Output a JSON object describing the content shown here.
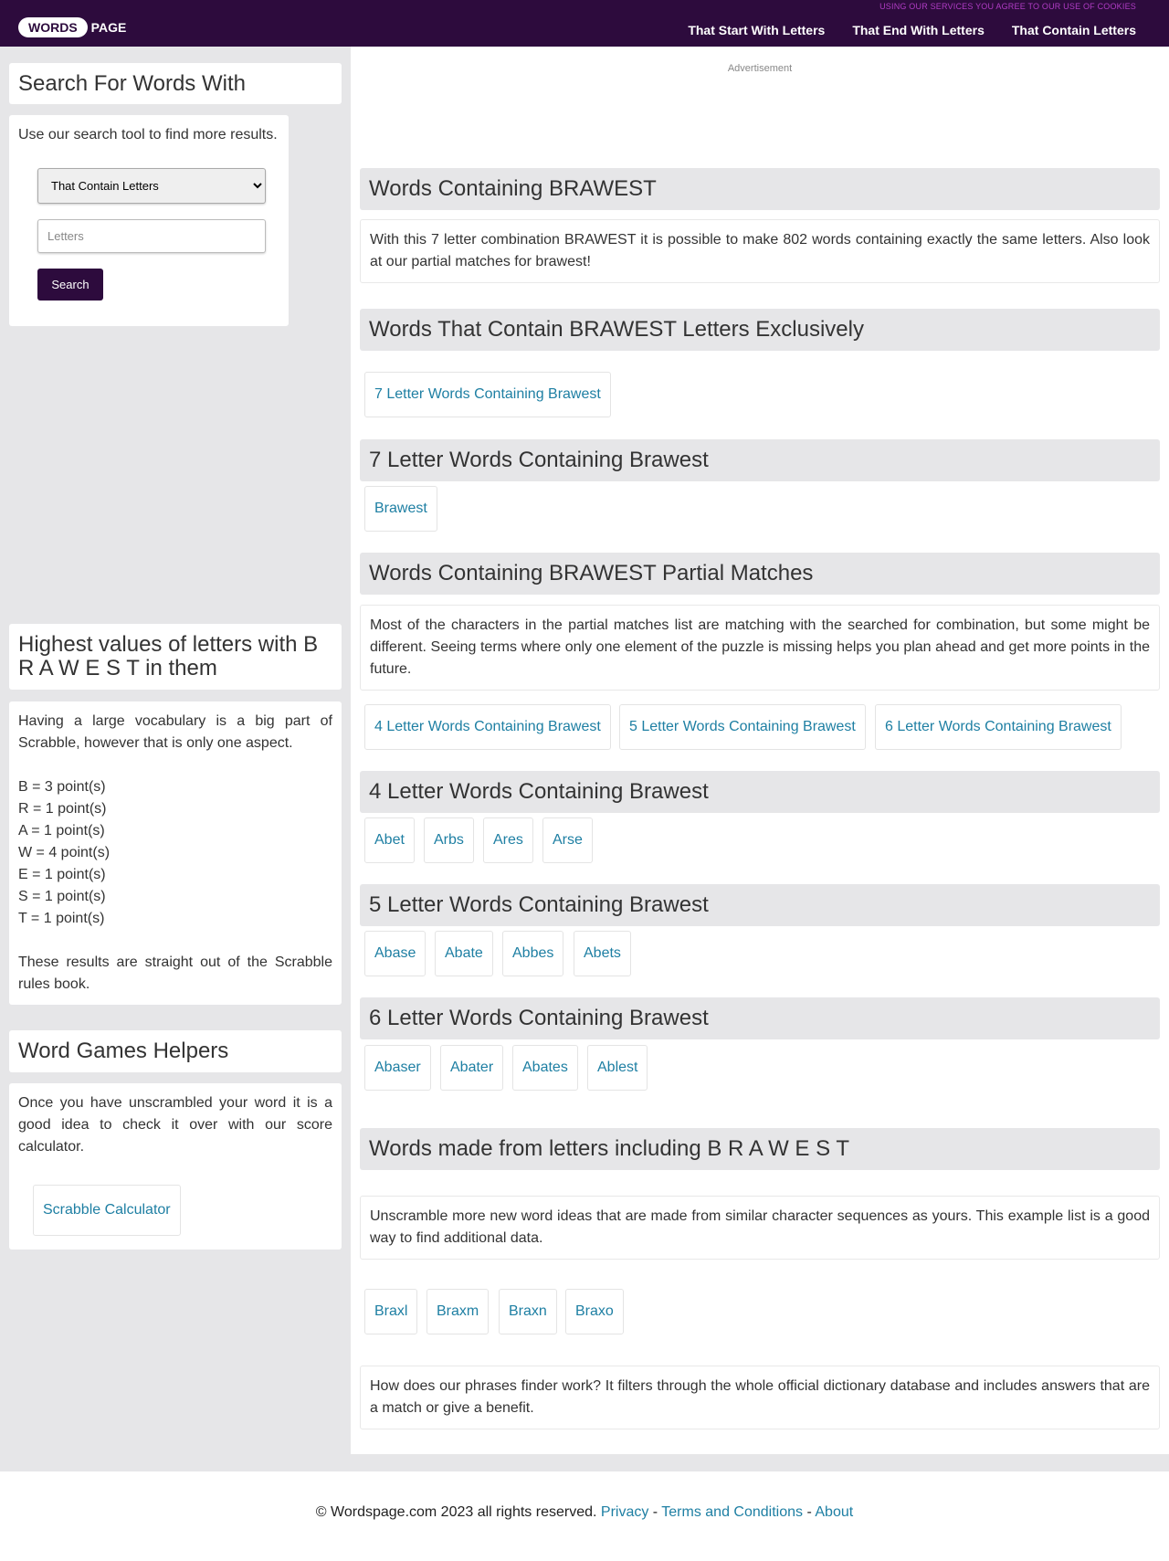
{
  "header": {
    "logo_pill": "WORDS",
    "logo_text": "PAGE",
    "cookie_note": "USING OUR SERVICES YOU AGREE TO OUR USE OF COOKIES",
    "nav": [
      "That Start With Letters",
      "That End With Letters",
      "That Contain Letters"
    ]
  },
  "sidebar": {
    "search_title": "Search For Words With",
    "search_intro": "Use our search tool to find more results.",
    "select_value": "That Contain Letters",
    "letters_placeholder": "Letters",
    "search_button": "Search",
    "highest_title": "Highest values of letters with B R A W E S T in them",
    "highest_intro": "Having a large vocabulary is a big part of Scrabble, however that is only one aspect.",
    "scores": [
      "B = 3 point(s)",
      "R = 1 point(s)",
      "A = 1 point(s)",
      "W = 4 point(s)",
      "E = 1 point(s)",
      "S = 1 point(s)",
      "T = 1 point(s)"
    ],
    "highest_outro": "These results are straight out of the Scrabble rules book.",
    "helpers_title": "Word Games Helpers",
    "helpers_text": "Once you have unscrambled your word it is a good idea to check it over with our score calculator.",
    "calculator_link": "Scrabble Calculator"
  },
  "main": {
    "ad_label": "Advertisement",
    "containing_title": "Words Containing BRAWEST",
    "containing_text": "With this 7 letter combination BRAWEST it is possible to make 802 words containing exactly the same letters. Also look at our partial matches for brawest!",
    "exclusive_title": "Words That Contain BRAWEST Letters Exclusively",
    "exclusive_links": [
      "7 Letter Words Containing Brawest"
    ],
    "seven_title": "7 Letter Words Containing Brawest",
    "seven_words": [
      "Brawest"
    ],
    "partial_title": "Words Containing BRAWEST Partial Matches",
    "partial_text": "Most of the characters in the partial matches list are matching with the searched for combination, but some might be different. Seeing terms where only one element of the puzzle is missing helps you plan ahead and get more points in the future.",
    "partial_links": [
      "4 Letter Words Containing Brawest",
      "5 Letter Words Containing Brawest",
      "6 Letter Words Containing Brawest"
    ],
    "four_title": "4 Letter Words Containing Brawest",
    "four_words": [
      "Abet",
      "Arbs",
      "Ares",
      "Arse"
    ],
    "five_title": "5 Letter Words Containing Brawest",
    "five_words": [
      "Abase",
      "Abate",
      "Abbes",
      "Abets"
    ],
    "six_title": "6 Letter Words Containing Brawest",
    "six_words": [
      "Abaser",
      "Abater",
      "Abates",
      "Ablest"
    ],
    "made_title": "Words made from letters including B R A W E S T",
    "made_text": "Unscramble more new word ideas that are made from similar character sequences as yours. This example list is a good way to find additional data.",
    "made_words": [
      "Braxl",
      "Braxm",
      "Braxn",
      "Braxo"
    ],
    "finder_text": "How does our phrases finder work? It filters through the whole official dictionary database and includes answers that are a match or give a benefit."
  },
  "footer": {
    "copyright": "© Wordspage.com 2023 all rights reserved.",
    "links": [
      "Privacy",
      "Terms and Conditions",
      "About"
    ],
    "separator": "-"
  }
}
